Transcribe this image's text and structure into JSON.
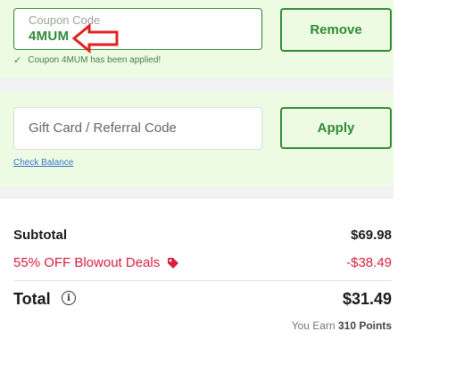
{
  "coupon": {
    "float_label": "Coupon Code",
    "value": "4MUM",
    "remove_label": "Remove",
    "applied_message": "Coupon 4MUM has been applied!"
  },
  "gift_card": {
    "placeholder": "Gift Card / Referral Code",
    "apply_label": "Apply",
    "check_balance_label": "Check Balance"
  },
  "summary": {
    "subtotal_label": "Subtotal",
    "subtotal_value": "$69.98",
    "discount_label": "55% OFF Blowout Deals",
    "discount_value": "-$38.49",
    "total_label": "Total",
    "total_value": "$31.49",
    "points_prefix": "You Earn",
    "points_value": "310 Points"
  },
  "colors": {
    "accent": "#2f8a35",
    "panel_bg": "#edfbe3",
    "discount": "#d61f3c",
    "annotation_arrow": "#e02020"
  },
  "icons": [
    "check-icon",
    "tag-icon",
    "info-icon",
    "annotation-arrow-icon"
  ]
}
